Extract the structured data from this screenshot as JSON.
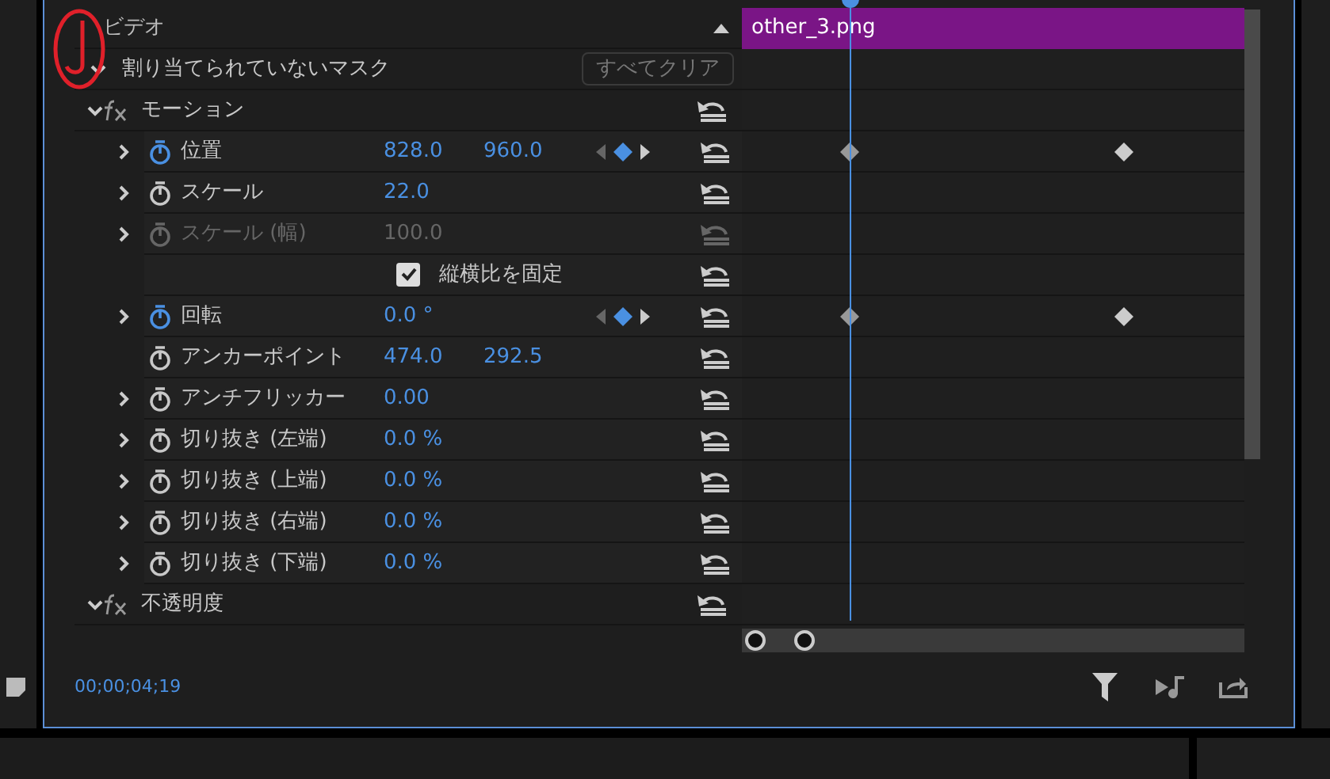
{
  "section": {
    "title": "ビデオ",
    "expanded": true
  },
  "mask": {
    "label": "割り当てられていないマスク",
    "button": "すべてクリア"
  },
  "clip": {
    "name": "other_3.png"
  },
  "effects": [
    {
      "name": "モーション",
      "expanded": true,
      "params": [
        {
          "kind": "param",
          "name": "位置",
          "expandable": true,
          "animated": true,
          "disabled": false,
          "values": [
            "828.0",
            "960.0"
          ],
          "keyframe_nav": true
        },
        {
          "kind": "param",
          "name": "スケール",
          "expandable": true,
          "animated": false,
          "disabled": false,
          "values": [
            "22.0"
          ],
          "keyframe_nav": false
        },
        {
          "kind": "param",
          "name": "スケール (幅)",
          "expandable": true,
          "animated": false,
          "disabled": true,
          "values": [
            "100.0"
          ],
          "keyframe_nav": false
        },
        {
          "kind": "checkbox",
          "name": "縦横比を固定",
          "checked": true
        },
        {
          "kind": "param",
          "name": "回転",
          "expandable": true,
          "animated": true,
          "disabled": false,
          "values": [
            "0.0 °"
          ],
          "keyframe_nav": true
        },
        {
          "kind": "param",
          "name": "アンカーポイント",
          "expandable": false,
          "animated": false,
          "disabled": false,
          "values": [
            "474.0",
            "292.5"
          ],
          "keyframe_nav": false
        },
        {
          "kind": "param",
          "name": "アンチフリッカー",
          "expandable": true,
          "animated": false,
          "disabled": false,
          "values": [
            "0.00"
          ],
          "keyframe_nav": false
        },
        {
          "kind": "param",
          "name": "切り抜き (左端)",
          "expandable": true,
          "animated": false,
          "disabled": false,
          "values": [
            "0.0 %"
          ],
          "keyframe_nav": false
        },
        {
          "kind": "param",
          "name": "切り抜き (上端)",
          "expandable": true,
          "animated": false,
          "disabled": false,
          "values": [
            "0.0 %"
          ],
          "keyframe_nav": false
        },
        {
          "kind": "param",
          "name": "切り抜き (右端)",
          "expandable": true,
          "animated": false,
          "disabled": false,
          "values": [
            "0.0 %"
          ],
          "keyframe_nav": false
        },
        {
          "kind": "param",
          "name": "切り抜き (下端)",
          "expandable": true,
          "animated": false,
          "disabled": false,
          "values": [
            "0.0 %"
          ],
          "keyframe_nav": false
        }
      ]
    },
    {
      "name": "不透明度",
      "expanded": true
    }
  ],
  "timecode": "00;00;04;19"
}
